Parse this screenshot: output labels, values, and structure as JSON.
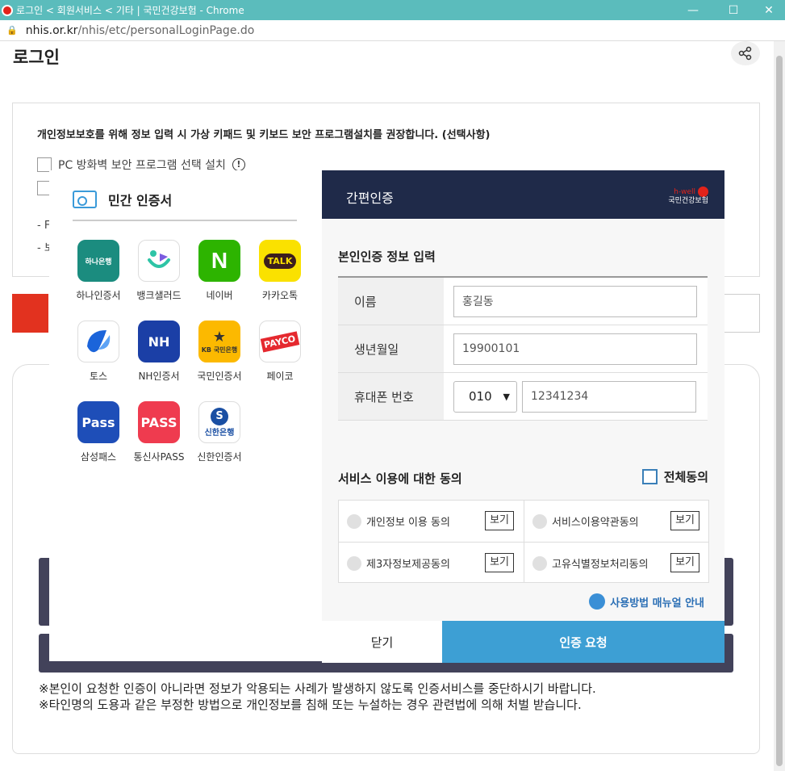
{
  "window": {
    "title": "로그인 < 회원서비스 < 기타 | 국민건강보험 - Chrome",
    "minimize": "—",
    "maximize": "☐",
    "close": "✕"
  },
  "address": {
    "host": "nhis.or.kr",
    "path": "/nhis/etc/personalLoginPage.do"
  },
  "page": {
    "title": "로그인",
    "notice": "개인정보보호를 위해 정보 입력 시 가상 키패드 및 키보드 보안 프로그램설치를 권장합니다. (선택사항)",
    "checkbox1": "PC 방화벽 보안 프로그램 선택 설치",
    "info_mark": "!",
    "bullet1": "- F",
    "bullet2": "- 보",
    "warning1": "※본인이 요청한 인증이 아니라면 정보가 악용되는 사례가 발생하지 않도록 인증서비스를 중단하시기 바랍니다.",
    "warning2": "※타인명의 도용과 같은 부정한 방법으로 개인정보를 침해 또는 누설하는 경우 관련법에 의해 처벌 받습니다."
  },
  "private_cert": {
    "title": "민간 인증서",
    "apps": [
      {
        "label": "하나인증서",
        "tile_text": "하나은행",
        "color": "#1b8c7f"
      },
      {
        "label": "뱅크샐러드",
        "tile_text": "",
        "color": "#ffffff"
      },
      {
        "label": "네이버",
        "tile_text": "N",
        "color": "#2db400"
      },
      {
        "label": "카카오톡",
        "tile_text": "TALK",
        "color": "#fae100"
      },
      {
        "label": "토스",
        "tile_text": "",
        "color": "#ffffff"
      },
      {
        "label": "NH인증서",
        "tile_text": "NH",
        "color": "#1b3fa6"
      },
      {
        "label": "국민인증서",
        "tile_text": "KB 국민은행",
        "color": "#fcb900"
      },
      {
        "label": "페이코",
        "tile_text": "PAYCO",
        "color": "#ffffff"
      },
      {
        "label": "삼성패스",
        "tile_text": "Pass",
        "color": "#1e4eb8"
      },
      {
        "label": "통신사PASS",
        "tile_text": "PASS",
        "color": "#ef3b4f"
      },
      {
        "label": "신한인증서",
        "tile_text": "신한은행",
        "color": "#ffffff"
      }
    ]
  },
  "modal": {
    "title": "간편인증",
    "logo_text1": "h-well",
    "logo_text2": "국민건강보험",
    "section_title": "본인인증 정보 입력",
    "name_label": "이름",
    "name_value": "홍길동",
    "birth_label": "생년월일",
    "birth_value": "19900101",
    "phone_label": "휴대폰 번호",
    "phone_prefix": "010",
    "phone_value": "12341234",
    "consent_title": "서비스 이용에 대한 동의",
    "agree_all": "전체동의",
    "agreements": [
      {
        "label": "개인정보 이용 동의",
        "view": "보기"
      },
      {
        "label": "서비스이용약관동의",
        "view": "보기"
      },
      {
        "label": "제3자정보제공동의",
        "view": "보기"
      },
      {
        "label": "고유식별정보처리동의",
        "view": "보기"
      }
    ],
    "manual": "사용방법 매뉴얼 안내",
    "close_btn": "닫기",
    "request_btn": "인증 요청"
  }
}
